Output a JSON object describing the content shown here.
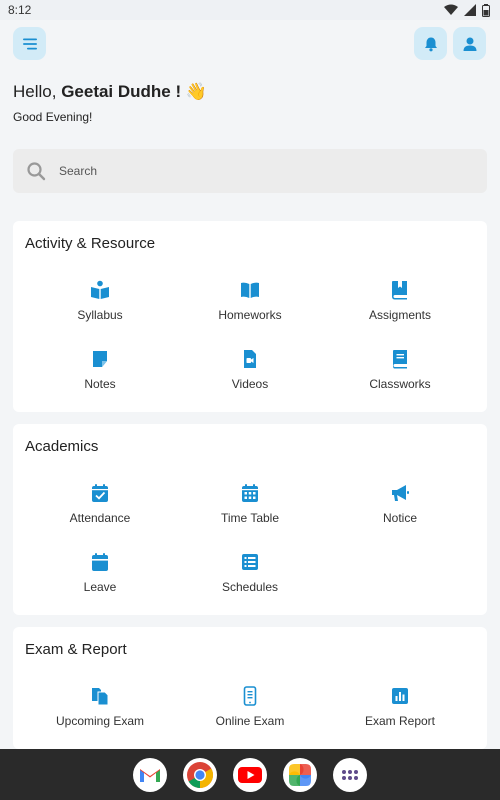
{
  "status_bar": {
    "time": "8:12"
  },
  "greeting": {
    "prefix": "Hello, ",
    "name": "Geetai Dudhe !",
    "emoji": "👋",
    "subtitle": "Good Evening!"
  },
  "search": {
    "placeholder": "Search"
  },
  "sections": [
    {
      "title": "Activity & Resource",
      "items": [
        {
          "label": "Syllabus",
          "icon": "book-reader-icon"
        },
        {
          "label": "Homeworks",
          "icon": "open-book-icon"
        },
        {
          "label": "Assigments",
          "icon": "bookmark-book-icon"
        },
        {
          "label": "Notes",
          "icon": "note-icon"
        },
        {
          "label": "Videos",
          "icon": "video-file-icon"
        },
        {
          "label": "Classworks",
          "icon": "closed-book-icon"
        }
      ]
    },
    {
      "title": "Academics",
      "items": [
        {
          "label": "Attendance",
          "icon": "calendar-check-icon"
        },
        {
          "label": "Time Table",
          "icon": "calendar-grid-icon"
        },
        {
          "label": "Notice",
          "icon": "megaphone-icon"
        },
        {
          "label": "Leave",
          "icon": "calendar-icon"
        },
        {
          "label": "Schedules",
          "icon": "list-icon"
        }
      ]
    },
    {
      "title": "Exam & Report",
      "items": [
        {
          "label": "Upcoming Exam",
          "icon": "documents-icon"
        },
        {
          "label": "Online Exam",
          "icon": "phone-exam-icon"
        },
        {
          "label": "Exam Report",
          "icon": "chart-report-icon"
        }
      ]
    }
  ],
  "nav_apps": [
    "gmail-icon",
    "chrome-icon",
    "youtube-icon",
    "photos-icon",
    "app-drawer-icon"
  ],
  "colors": {
    "accent": "#1a8fd1",
    "icon_bg": "#d2ebf7"
  }
}
